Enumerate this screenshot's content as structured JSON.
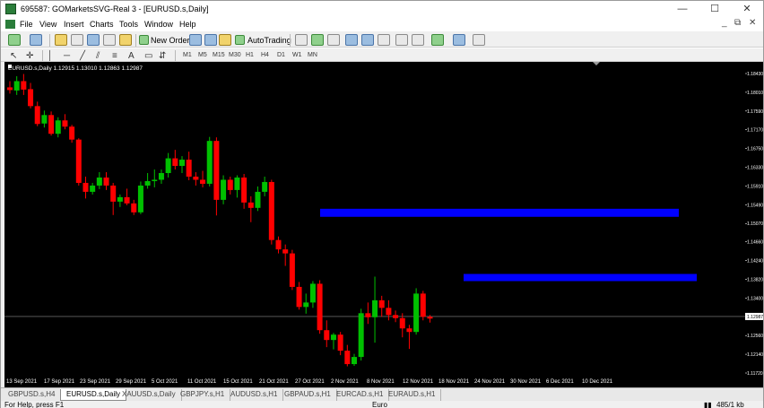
{
  "window": {
    "title": "695587: GOMarketsSVG-Real 3 - [EURUSD.s,Daily]",
    "controls": [
      "—",
      "☐",
      "✕"
    ]
  },
  "menu": [
    "File",
    "View",
    "Insert",
    "Charts",
    "Tools",
    "Window",
    "Help"
  ],
  "mdi_controls": [
    "_",
    "⧉",
    "✕"
  ],
  "toolbar": {
    "new_order": "New Order",
    "autotrading": "AutoTrading",
    "timeframes": [
      "M1",
      "M5",
      "M15",
      "M30",
      "H1",
      "H4",
      "D1",
      "W1",
      "MN"
    ],
    "text_tool": "A"
  },
  "chart": {
    "header": "EURUSD.s,Daily  1.12915 1.13010 1.12863 1.12987",
    "current_price": "1.12987",
    "bull_color": "#00c000",
    "bear_color": "#ff0000",
    "zone_color": "#0000ff",
    "background": "#000000"
  },
  "chart_data": {
    "type": "candlestick",
    "price_labels": [
      "1.18430",
      "1.18010",
      "1.17590",
      "1.17170",
      "1.16750",
      "1.16330",
      "1.15910",
      "1.15490",
      "1.15070",
      "1.14660",
      "1.14240",
      "1.13820",
      "1.13400",
      "1.12987",
      "1.12560",
      "1.12140",
      "1.11720"
    ],
    "price_values": [
      1.1843,
      1.1801,
      1.1759,
      1.1717,
      1.1675,
      1.1633,
      1.1591,
      1.1549,
      1.1507,
      1.1466,
      1.1424,
      1.1382,
      1.134,
      1.12987,
      1.1256,
      1.1214,
      1.1172
    ],
    "date_labels": [
      "13 Sep 2021",
      "17 Sep 2021",
      "23 Sep 2021",
      "29 Sep 2021",
      "5 Oct 2021",
      "11 Oct 2021",
      "15 Oct 2021",
      "21 Oct 2021",
      "27 Oct 2021",
      "2 Nov 2021",
      "8 Nov 2021",
      "12 Nov 2021",
      "18 Nov 2021",
      "24 Nov 2021",
      "30 Nov 2021",
      "6 Dec 2021",
      "10 Dec 2021"
    ],
    "candles": [
      [
        1.1812,
        1.1826,
        1.1798,
        1.1806
      ],
      [
        1.1805,
        1.1837,
        1.1795,
        1.1826
      ],
      [
        1.1826,
        1.1842,
        1.1795,
        1.1807
      ],
      [
        1.1808,
        1.1822,
        1.1765,
        1.177
      ],
      [
        1.177,
        1.178,
        1.1725,
        1.173
      ],
      [
        1.1731,
        1.176,
        1.1722,
        1.175
      ],
      [
        1.175,
        1.1758,
        1.1704,
        1.1708
      ],
      [
        1.1708,
        1.1745,
        1.17,
        1.1738
      ],
      [
        1.1738,
        1.1752,
        1.1718,
        1.1724
      ],
      [
        1.1724,
        1.1728,
        1.1688,
        1.1695
      ],
      [
        1.1695,
        1.1698,
        1.1592,
        1.1598
      ],
      [
        1.1598,
        1.1612,
        1.1563,
        1.1578
      ],
      [
        1.1578,
        1.1598,
        1.1572,
        1.1592
      ],
      [
        1.1592,
        1.1622,
        1.1584,
        1.161
      ],
      [
        1.161,
        1.1622,
        1.1582,
        1.1592
      ],
      [
        1.1592,
        1.1598,
        1.1526,
        1.1556
      ],
      [
        1.1556,
        1.1572,
        1.1544,
        1.1566
      ],
      [
        1.1566,
        1.1585,
        1.1548,
        1.1552
      ],
      [
        1.1552,
        1.156,
        1.1526,
        1.1532
      ],
      [
        1.1532,
        1.1601,
        1.1528,
        1.1592
      ],
      [
        1.1592,
        1.162,
        1.1585,
        1.1602
      ],
      [
        1.1602,
        1.1628,
        1.1588,
        1.1605
      ],
      [
        1.1605,
        1.1628,
        1.1596,
        1.162
      ],
      [
        1.162,
        1.1665,
        1.161,
        1.1653
      ],
      [
        1.1653,
        1.1672,
        1.1628,
        1.1636
      ],
      [
        1.1636,
        1.1658,
        1.162,
        1.165
      ],
      [
        1.165,
        1.1668,
        1.1604,
        1.1612
      ],
      [
        1.1612,
        1.1622,
        1.1592,
        1.1605
      ],
      [
        1.1605,
        1.1625,
        1.1588,
        1.1596
      ],
      [
        1.1596,
        1.1701,
        1.159,
        1.1692
      ],
      [
        1.1692,
        1.17,
        1.1525,
        1.156
      ],
      [
        1.156,
        1.1615,
        1.155,
        1.1605
      ],
      [
        1.1605,
        1.1612,
        1.1572,
        1.1582
      ],
      [
        1.1582,
        1.1615,
        1.1565,
        1.161
      ],
      [
        1.161,
        1.1618,
        1.154,
        1.1554
      ],
      [
        1.1554,
        1.1568,
        1.151,
        1.1542
      ],
      [
        1.1542,
        1.159,
        1.1535,
        1.1578
      ],
      [
        1.1578,
        1.1612,
        1.1568,
        1.16
      ],
      [
        1.16,
        1.1605,
        1.146,
        1.147
      ],
      [
        1.147,
        1.1478,
        1.144,
        1.1449
      ],
      [
        1.1449,
        1.146,
        1.1412,
        1.144
      ],
      [
        1.144,
        1.1448,
        1.1358,
        1.1365
      ],
      [
        1.1365,
        1.1376,
        1.1314,
        1.132
      ],
      [
        1.132,
        1.135,
        1.1305,
        1.133
      ],
      [
        1.133,
        1.1378,
        1.1318,
        1.1372
      ],
      [
        1.1372,
        1.138,
        1.126,
        1.1268
      ],
      [
        1.1268,
        1.129,
        1.123,
        1.1246
      ],
      [
        1.1246,
        1.1262,
        1.1225,
        1.1258
      ],
      [
        1.1258,
        1.1264,
        1.1212,
        1.1222
      ],
      [
        1.1222,
        1.1235,
        1.1187,
        1.1192
      ],
      [
        1.1192,
        1.1215,
        1.1188,
        1.1208
      ],
      [
        1.1208,
        1.1316,
        1.12,
        1.1306
      ],
      [
        1.1306,
        1.133,
        1.1282,
        1.1297
      ],
      [
        1.1297,
        1.1388,
        1.124,
        1.1335
      ],
      [
        1.1335,
        1.1345,
        1.1298,
        1.1318
      ],
      [
        1.1318,
        1.1335,
        1.129,
        1.1302
      ],
      [
        1.1302,
        1.1312,
        1.1286,
        1.1295
      ],
      [
        1.1295,
        1.1306,
        1.1252,
        1.1272
      ],
      [
        1.1272,
        1.128,
        1.1226,
        1.1264
      ],
      [
        1.1264,
        1.1362,
        1.1258,
        1.135
      ],
      [
        1.135,
        1.1356,
        1.129,
        1.1298
      ],
      [
        1.1298,
        1.1302,
        1.1285,
        1.1294
      ]
    ],
    "zones": [
      {
        "from": "2 Nov 2021",
        "to": "13 Dec 2021",
        "top": 1.154,
        "bottom": 1.1522
      },
      {
        "from": "18 Nov 2021",
        "to": "14 Dec 2021",
        "top": 1.1394,
        "bottom": 1.1378
      }
    ],
    "ylim": [
      1.1172,
      1.1843
    ]
  },
  "tabs": [
    "GBPUSD.s,H4",
    "EURUSD.s,Daily",
    "XAUUSD.s,Daily",
    "GBPJPY.s,H1",
    "AUDUSD.s,H1",
    "GBPAUD.s,H1",
    "EURCAD.s,H1",
    "EURAUD.s,H1"
  ],
  "statusbar": {
    "help": "For Help, press F1",
    "profile": "Euro",
    "traffic": "485/1 kb"
  }
}
